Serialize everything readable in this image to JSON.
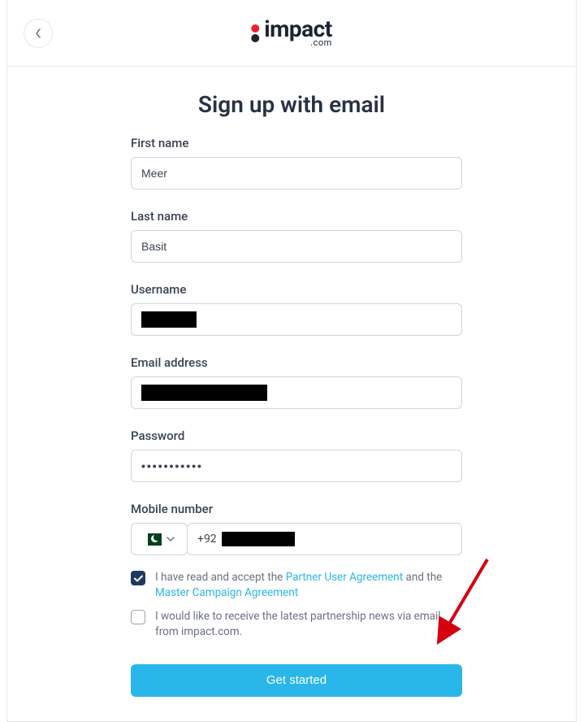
{
  "header": {
    "logo_text": "impact",
    "logo_suffix": ".com"
  },
  "form": {
    "title": "Sign up with email",
    "first_name_label": "First name",
    "first_name_value": "Meer",
    "last_name_label": "Last name",
    "last_name_value": "Basit",
    "username_label": "Username",
    "email_label": "Email address",
    "password_label": "Password",
    "password_value": "•••••••••••",
    "mobile_label": "Mobile number",
    "mobile_prefix": "+92",
    "country_code": "PK",
    "terms": {
      "pre": "I have read and accept the ",
      "link1": "Partner User Agreement",
      "mid": " and the ",
      "link2": "Master Campaign Agreement",
      "checked": true
    },
    "news": {
      "text": "I would like to receive the latest partnership news via email, from impact.com.",
      "checked": false
    },
    "submit_label": "Get started"
  }
}
